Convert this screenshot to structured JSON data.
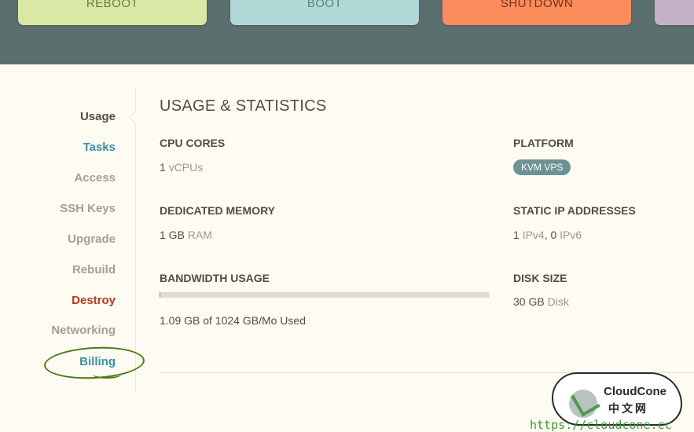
{
  "actions": {
    "reboot": "REBOOT",
    "boot": "BOOT",
    "shutdown": "SHUTDOWN"
  },
  "sidebar": {
    "items": [
      {
        "label": "Usage",
        "state": "active"
      },
      {
        "label": "Tasks",
        "state": "link"
      },
      {
        "label": "Access",
        "state": "normal"
      },
      {
        "label": "SSH Keys",
        "state": "normal"
      },
      {
        "label": "Upgrade",
        "state": "normal"
      },
      {
        "label": "Rebuild",
        "state": "normal"
      },
      {
        "label": "Destroy",
        "state": "danger"
      },
      {
        "label": "Networking",
        "state": "normal"
      },
      {
        "label": "Billing",
        "state": "highlighted"
      }
    ]
  },
  "main": {
    "title": "USAGE & STATISTICS",
    "cpu": {
      "label": "CPU CORES",
      "value": "1",
      "unit": "vCPUs"
    },
    "memory": {
      "label": "DEDICATED MEMORY",
      "value": "1 GB",
      "unit": "RAM"
    },
    "bandwidth": {
      "label": "BANDWIDTH USAGE",
      "used_text": "1.09 GB of 1024 GB/Mo Used",
      "used_fraction": 0.001
    },
    "platform": {
      "label": "PLATFORM",
      "badge": "KVM VPS"
    },
    "ips": {
      "label": "STATIC IP ADDRESSES",
      "ipv4_count": "1",
      "ipv4_unit": "IPv4",
      "separator": ",",
      "ipv6_count": "0",
      "ipv6_unit": "IPv6"
    },
    "disk": {
      "label": "DISK SIZE",
      "value": "30 GB",
      "unit": "Disk"
    }
  },
  "watermark": {
    "brand": "CloudCone",
    "cn": "中文网",
    "url": "https://cloudcone.cc"
  },
  "colors": {
    "topbar": "#5c6f6f",
    "reboot": "#d9e8a4",
    "boot": "#b3d8d8",
    "shutdown": "#fb8c5c",
    "accent": "#3a8fa6",
    "danger": "#b03a1c",
    "badge": "#6e9293"
  }
}
